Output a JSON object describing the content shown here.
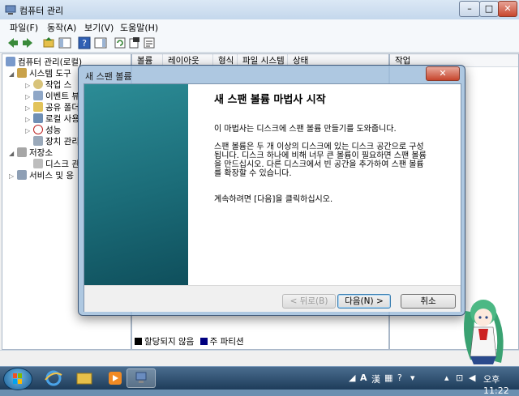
{
  "window": {
    "title": "컴퓨터 관리",
    "buttons": {
      "minimize": "–",
      "maximize": "□",
      "close": "✕"
    }
  },
  "menu": [
    "파일(F)",
    "동작(A)",
    "보기(V)",
    "도움말(H)"
  ],
  "toolbar": [
    "back-icon",
    "forward-icon",
    "up-icon",
    "show-hide-tree-icon",
    "help-icon",
    "show-hide-action-icon",
    "refresh-icon",
    "export-icon",
    "properties-icon"
  ],
  "tree": {
    "root": "컴퓨터 관리(로컬)",
    "system_tools": "시스템 도구",
    "task_scheduler": "작업 스",
    "event_viewer": "이벤트 뷰",
    "shared_folders": "공유 폴더",
    "local_users": "로컬 사용",
    "performance": "성능",
    "device_manager": "장치 관리",
    "storage": "저장소",
    "disk_management": "디스크 관",
    "services": "서비스 및 응"
  },
  "list": {
    "columns": [
      "볼륨",
      "레이아웃",
      "형식",
      "파일 시스템",
      "상태"
    ]
  },
  "actions": {
    "header": "작업"
  },
  "legend": {
    "unallocated": "할당되지 않음",
    "primary": "주 파티션"
  },
  "dialog": {
    "title": "새 스팬 볼륨",
    "close": "✕",
    "heading": "새 스팬 볼륨 마법사 시작",
    "intro": "이 마법사는 디스크에 스팬 볼륨 만들기를 도와줍니다.",
    "desc_line1": "스팬 볼륨은 두 개 이상의 디스크에 있는 디스크 공간으로 구성",
    "desc_line2": "됩니다. 디스크 하나에 비해 너무 큰 볼륨이 필요하면 스팬 볼륨",
    "desc_line3": "을 만드십시오. 다른 디스크에서 빈 공간을 추가하여 스팬 볼륨",
    "desc_line4": "를 확장할 수 있습니다.",
    "continue_text": "계속하려면 [다음]을 클릭하십시오.",
    "back_button": "< 뒤로(B)",
    "next_button": "다음(N) >",
    "cancel_button": "취소"
  },
  "taskbar": {
    "tray_a": "A",
    "tray_han": "漢",
    "time": "오후 11:22"
  },
  "colors": {
    "wizard_side": "#1b6c78",
    "unallocated": "#000000",
    "primary_partition": "#000080"
  }
}
